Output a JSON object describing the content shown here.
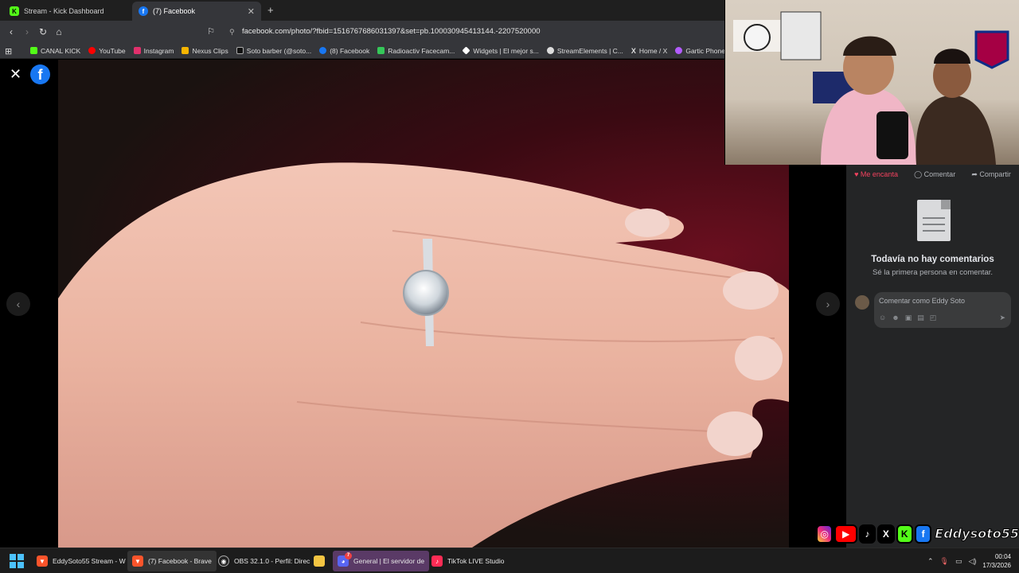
{
  "tabs": [
    {
      "label": "Stream - Kick Dashboard",
      "icon": "kick-icon"
    },
    {
      "label": "(7) Facebook",
      "icon": "facebook-icon"
    }
  ],
  "address": {
    "url": "facebook.com/photo/?fbid=1516767686031397&set=pb.100030945413144.-2207520000"
  },
  "bookmarks": [
    {
      "label": "CANAL KICK",
      "color": "#53fc18"
    },
    {
      "label": "YouTube",
      "color": "#ff0000"
    },
    {
      "label": "Instagram",
      "color": "#e1306c"
    },
    {
      "label": "Nexus Clips",
      "color": "#f7b500"
    },
    {
      "label": "Soto barber (@soto...",
      "color": "#111111"
    },
    {
      "label": "(8) Facebook",
      "color": "#1877f2"
    },
    {
      "label": "Radioactiv Facecam...",
      "color": "#35c759"
    },
    {
      "label": "Widgets | El mejor s...",
      "color": "#ffffff"
    },
    {
      "label": "StreamElements | C...",
      "color": "#dddddd"
    },
    {
      "label": "Home / X",
      "color": "#000000"
    },
    {
      "label": "Gartic Phone - Tele",
      "color": "#b35cff"
    }
  ],
  "sidebar": {
    "like_label": "Me encanta",
    "comment_label": "Comentar",
    "share_label": "Compartir",
    "no_comments_title": "Todavía no hay comentarios",
    "no_comments_sub": "Sé la primera persona en comentar.",
    "comment_placeholder": "Comentar como Eddy Soto"
  },
  "overlay": {
    "handle": "Eddysoto55"
  },
  "taskbar": {
    "items": [
      {
        "label": "EddySoto55 Stream - W",
        "icon": "brave-icon"
      },
      {
        "label": "(7) Facebook - Brave",
        "icon": "brave-icon"
      },
      {
        "label": "OBS 32.1.0 - Perfil: Direc",
        "icon": "obs-icon"
      },
      {
        "label": "General | El servidor de",
        "icon": "discord-icon",
        "badge": "7"
      },
      {
        "label": "TikTok LIVE Studio",
        "icon": "tiktok-icon"
      }
    ],
    "time": "00:04",
    "date": "17/3/2026"
  }
}
